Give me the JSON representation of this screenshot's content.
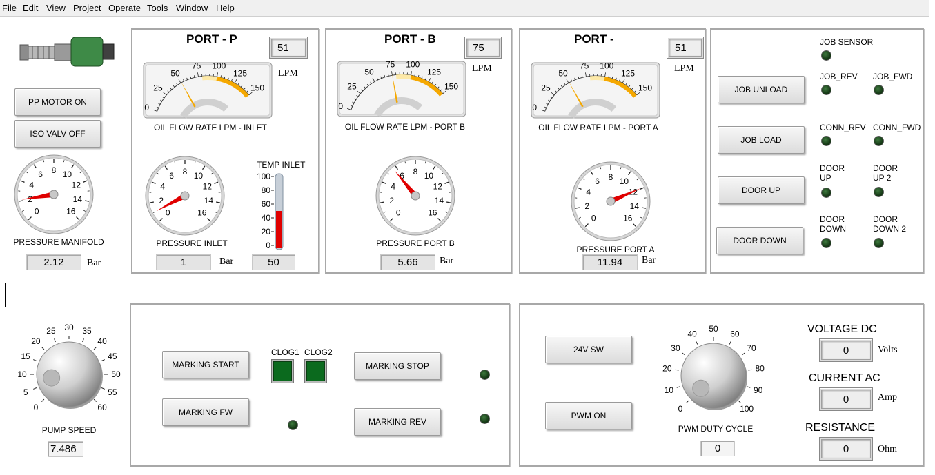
{
  "menu": [
    "File",
    "Edit",
    "View",
    "Project",
    "Operate",
    "Tools",
    "Window",
    "Help"
  ],
  "left": {
    "pp_motor_button": "PP MOTOR ON",
    "iso_valve_button": "ISO VALV OFF",
    "pressure_manifold_label": "PRESSURE MANIFOLD",
    "pressure_manifold_value": "2.12",
    "pressure_manifold_unit": "Bar",
    "pressure_manifold_scale": [
      "0",
      "2",
      "4",
      "6",
      "8",
      "10",
      "12",
      "14",
      "16"
    ],
    "text_box_value": "",
    "pump_speed_label": "PUMP SPEED",
    "pump_speed_value": "7.486",
    "pump_speed_scale": [
      "0",
      "5",
      "10",
      "15",
      "20",
      "25",
      "30",
      "35",
      "40",
      "45",
      "50",
      "55",
      "60"
    ]
  },
  "port_p": {
    "title": "PORT - P",
    "flow_value": "51",
    "flow_unit": "LPM",
    "flow_label": "OIL FLOW RATE LPM - INLET",
    "flow_scale": [
      "0",
      "25",
      "50",
      "75",
      "100",
      "125",
      "150"
    ],
    "pressure_label": "PRESSURE INLET",
    "pressure_value": "1",
    "pressure_unit": "Bar",
    "pressure_scale": [
      "0",
      "2",
      "4",
      "6",
      "8",
      "10",
      "12",
      "14",
      "16"
    ],
    "temp_label": "TEMP INLET",
    "temp_value": "50",
    "temp_scale": [
      "100",
      "80",
      "60",
      "40",
      "20",
      "0"
    ],
    "temp_level": 0.5
  },
  "port_b": {
    "title": "PORT - B",
    "flow_value": "75",
    "flow_unit": "LPM",
    "flow_label": "OIL FLOW RATE LPM - PORT B",
    "flow_scale": [
      "0",
      "25",
      "50",
      "75",
      "100",
      "125",
      "150"
    ],
    "pressure_label": "PRESSURE  PORT B",
    "pressure_value": "5.66",
    "pressure_unit": "Bar",
    "pressure_scale": [
      "0",
      "2",
      "4",
      "6",
      "8",
      "10",
      "12",
      "14",
      "16"
    ]
  },
  "port_a": {
    "title": "PORT -",
    "flow_value": "51",
    "flow_unit": "LPM",
    "flow_label": "OIL FLOW RATE LPM - PORT A",
    "flow_scale": [
      "0",
      "25",
      "50",
      "75",
      "100",
      "125",
      "150"
    ],
    "pressure_label": "PRESSURE  PORT A",
    "pressure_value": "11.94",
    "pressure_unit": "Bar",
    "pressure_scale": [
      "0",
      "2",
      "4",
      "6",
      "8",
      "10",
      "12",
      "14",
      "16"
    ]
  },
  "job": {
    "job_unload": "JOB UNLOAD",
    "job_load": "JOB LOAD",
    "door_up": "DOOR UP",
    "door_down": "DOOR DOWN",
    "job_sensor": "JOB SENSOR",
    "job_rev": "JOB_REV",
    "job_fwd": "JOB_FWD",
    "conn_rev": "CONN_REV",
    "conn_fwd": "CONN_FWD",
    "door_up_led_1": "DOOR",
    "door_up_led_2": "UP",
    "door_up2_led_1": "DOOR",
    "door_up2_led_2": "UP 2",
    "door_down_led_1": "DOOR",
    "door_down_led_2": "DOWN",
    "door_down2_led_1": "DOOR",
    "door_down2_led_2": "DOWN 2"
  },
  "marking": {
    "start": "MARKING START",
    "fw": "MARKING FW",
    "stop": "MARKING STOP",
    "rev": "MARKING REV",
    "clog1": "CLOG1",
    "clog2": "CLOG2"
  },
  "power": {
    "sw24": "24V SW",
    "pwm_on": "PWM ON",
    "pwm_label": "PWM DUTY CYCLE",
    "pwm_value": "0",
    "pwm_scale": [
      "0",
      "10",
      "20",
      "30",
      "40",
      "50",
      "60",
      "70",
      "80",
      "90",
      "100"
    ],
    "voltage_label": "VOLTAGE DC",
    "voltage_value": "0",
    "voltage_unit": "Volts",
    "current_label": "CURRENT AC",
    "current_value": "0",
    "current_unit": "Amp",
    "resistance_label": "RESISTANCE",
    "resistance_value": "0",
    "resistance_unit": "Ohm"
  },
  "colors": {
    "needle_red": "#e00000",
    "needle_orange": "#f5a800",
    "led_green": "#0b6a1e",
    "temp_fill": "#e00000"
  }
}
